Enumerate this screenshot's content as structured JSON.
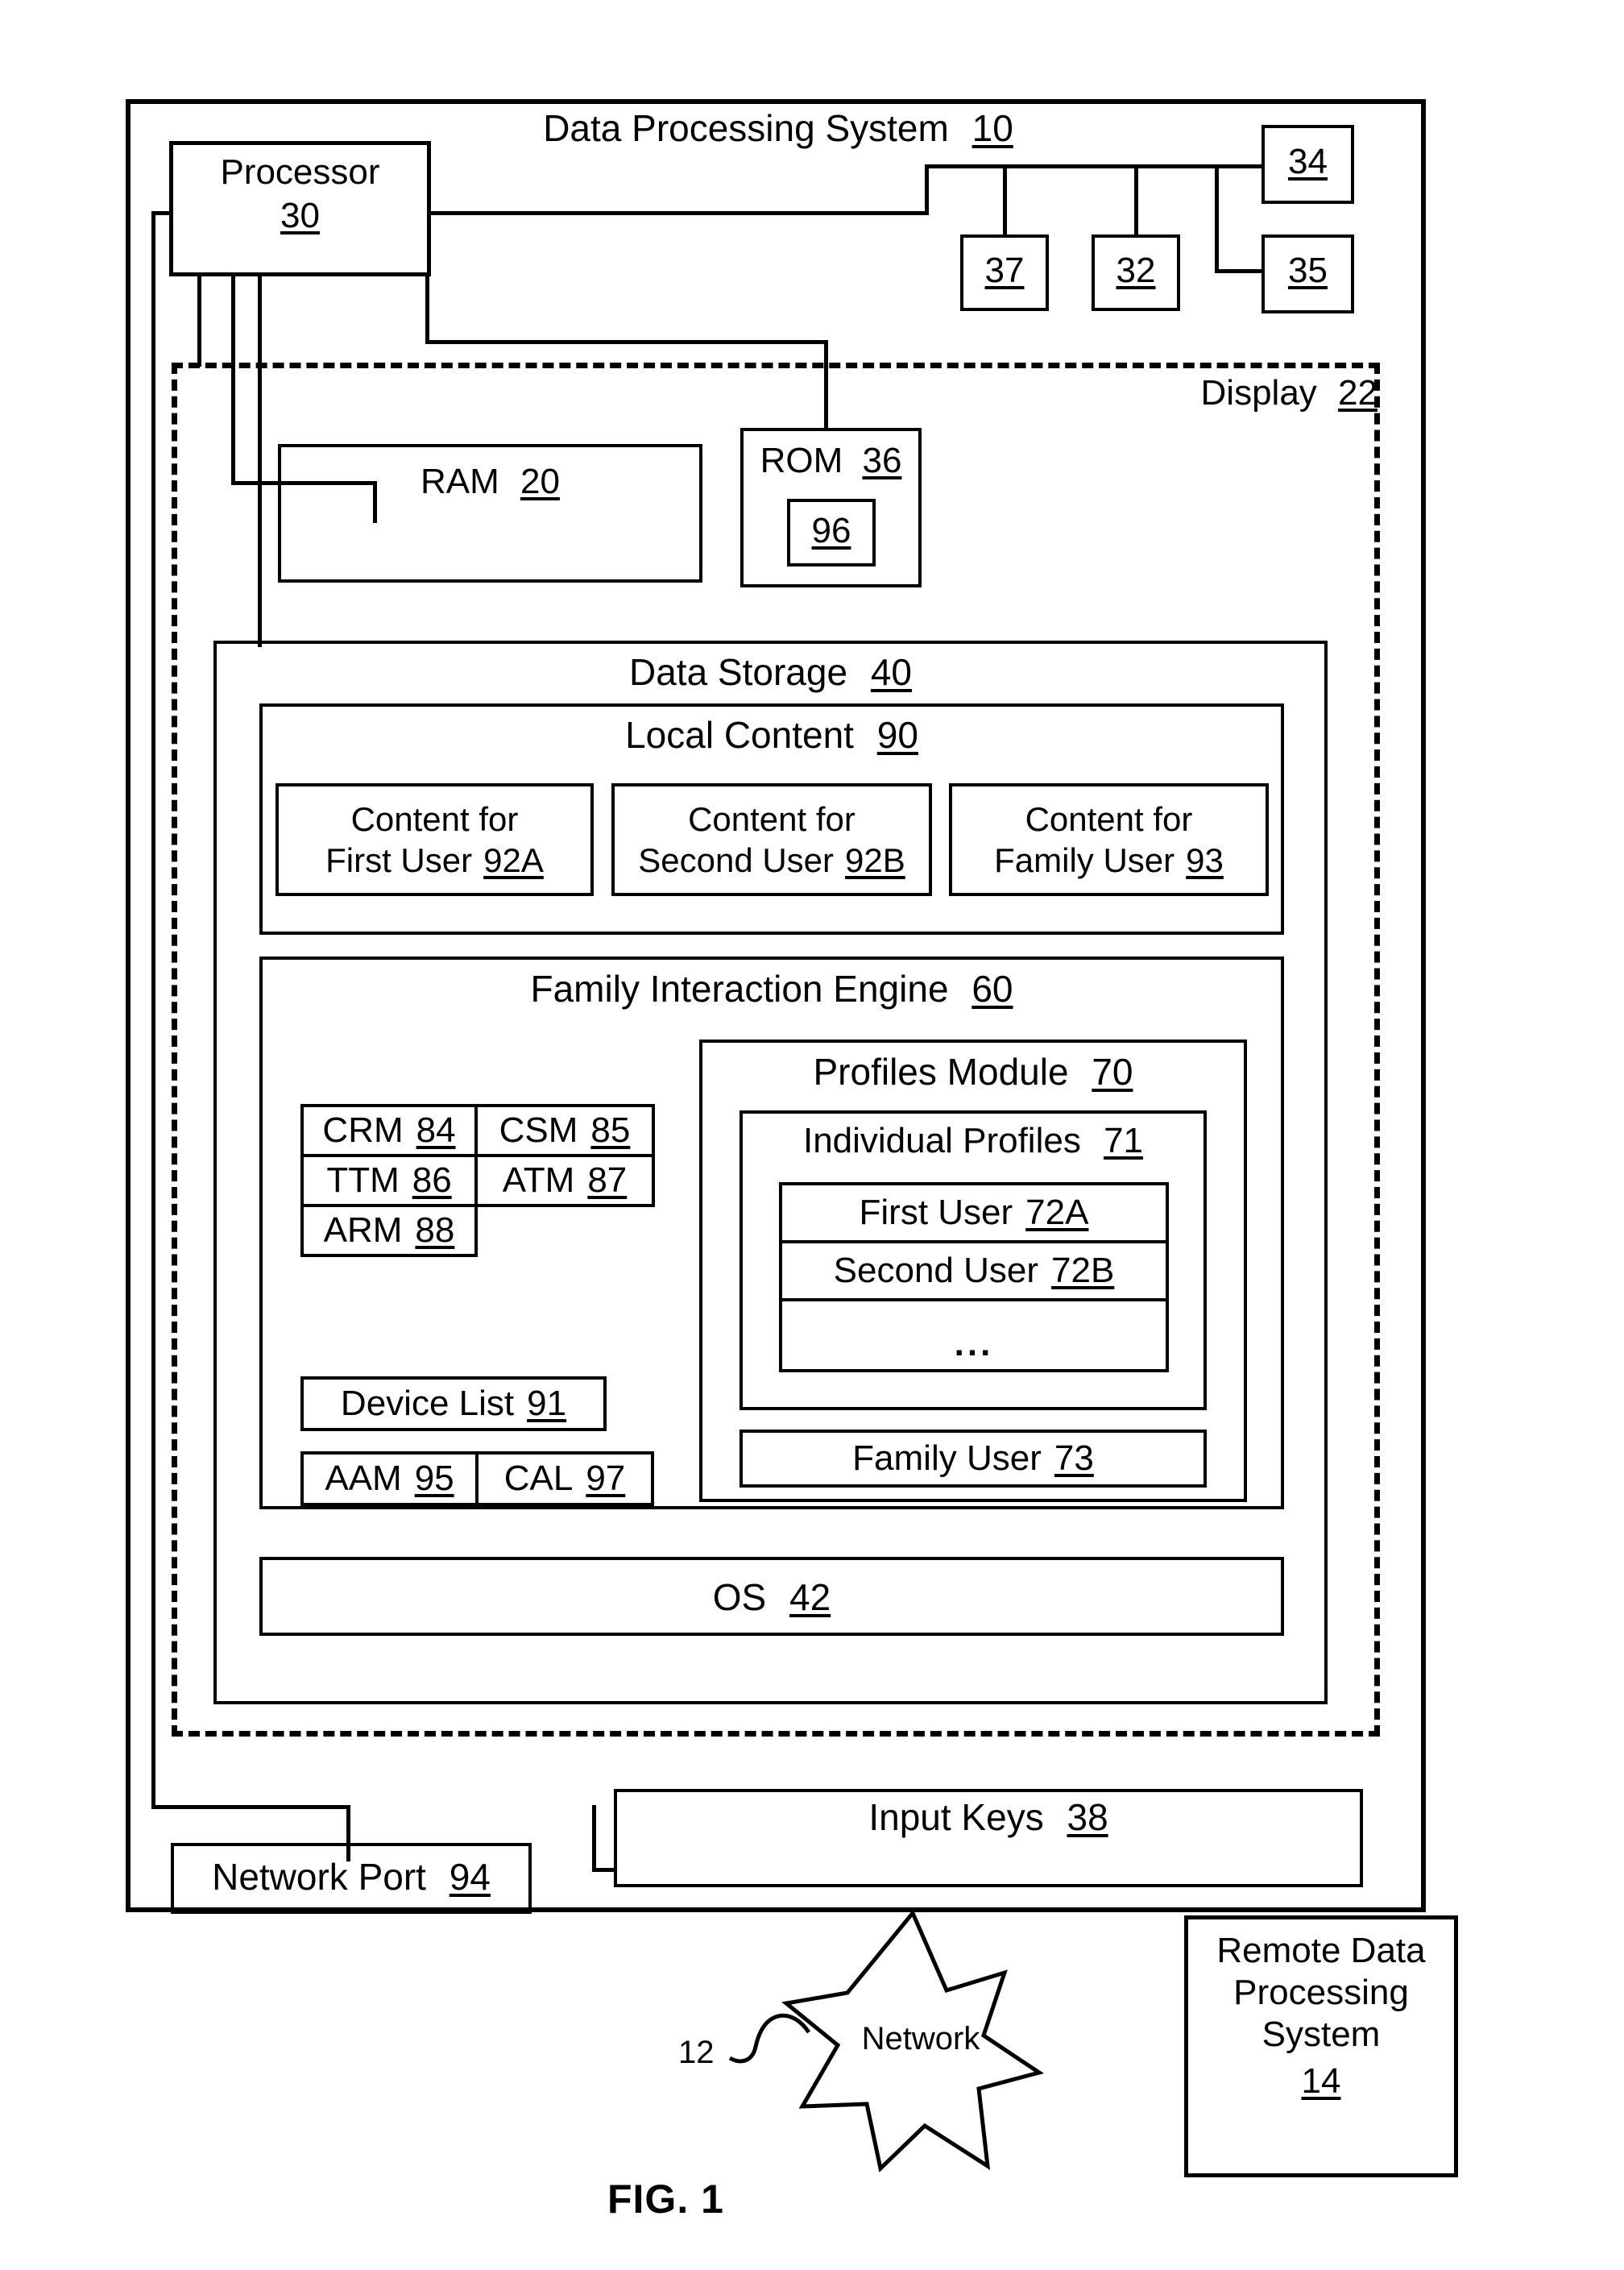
{
  "figure": {
    "caption": "FIG. 1"
  },
  "system": {
    "title": "Data Processing System",
    "ref": "10"
  },
  "processor": {
    "label": "Processor",
    "ref": "30"
  },
  "peripherals": [
    {
      "ref": "37"
    },
    {
      "ref": "32"
    },
    {
      "ref": "34"
    },
    {
      "ref": "35"
    }
  ],
  "display": {
    "label": "Display",
    "ref": "22"
  },
  "ram": {
    "label": "RAM",
    "ref": "20"
  },
  "rom": {
    "label": "ROM",
    "ref": "36",
    "inner_ref": "96"
  },
  "data_storage": {
    "label": "Data Storage",
    "ref": "40"
  },
  "local_content": {
    "label": "Local Content",
    "ref": "90",
    "items": [
      {
        "line1": "Content for",
        "line2": "First User",
        "ref": "92A"
      },
      {
        "line1": "Content for",
        "line2": "Second User",
        "ref": "92B"
      },
      {
        "line1": "Content for",
        "line2": "Family User",
        "ref": "93"
      }
    ]
  },
  "family_interaction_engine": {
    "label": "Family Interaction Engine",
    "ref": "60",
    "modules": [
      {
        "label": "CRM",
        "ref": "84"
      },
      {
        "label": "CSM",
        "ref": "85"
      },
      {
        "label": "TTM",
        "ref": "86"
      },
      {
        "label": "ATM",
        "ref": "87"
      },
      {
        "label": "ARM",
        "ref": "88"
      }
    ],
    "device_list": {
      "label": "Device List",
      "ref": "91"
    },
    "extras": [
      {
        "label": "AAM",
        "ref": "95"
      },
      {
        "label": "CAL",
        "ref": "97"
      }
    ]
  },
  "profiles_module": {
    "label": "Profiles Module",
    "ref": "70",
    "individual_profiles": {
      "label": "Individual Profiles",
      "ref": "71",
      "users": [
        {
          "label": "First User",
          "ref": "72A"
        },
        {
          "label": "Second User",
          "ref": "72B"
        },
        {
          "label": "...",
          "ref": ""
        }
      ]
    },
    "family_user": {
      "label": "Family User",
      "ref": "73"
    }
  },
  "os": {
    "label": "OS",
    "ref": "42"
  },
  "network_port": {
    "label": "Network Port",
    "ref": "94"
  },
  "input_keys": {
    "label": "Input Keys",
    "ref": "38"
  },
  "network": {
    "label": "Network",
    "ref": "12"
  },
  "remote_system": {
    "line1": "Remote Data",
    "line2": "Processing",
    "line3": "System",
    "ref": "14"
  },
  "colors": {
    "ink": "#000000",
    "paper": "#ffffff"
  }
}
